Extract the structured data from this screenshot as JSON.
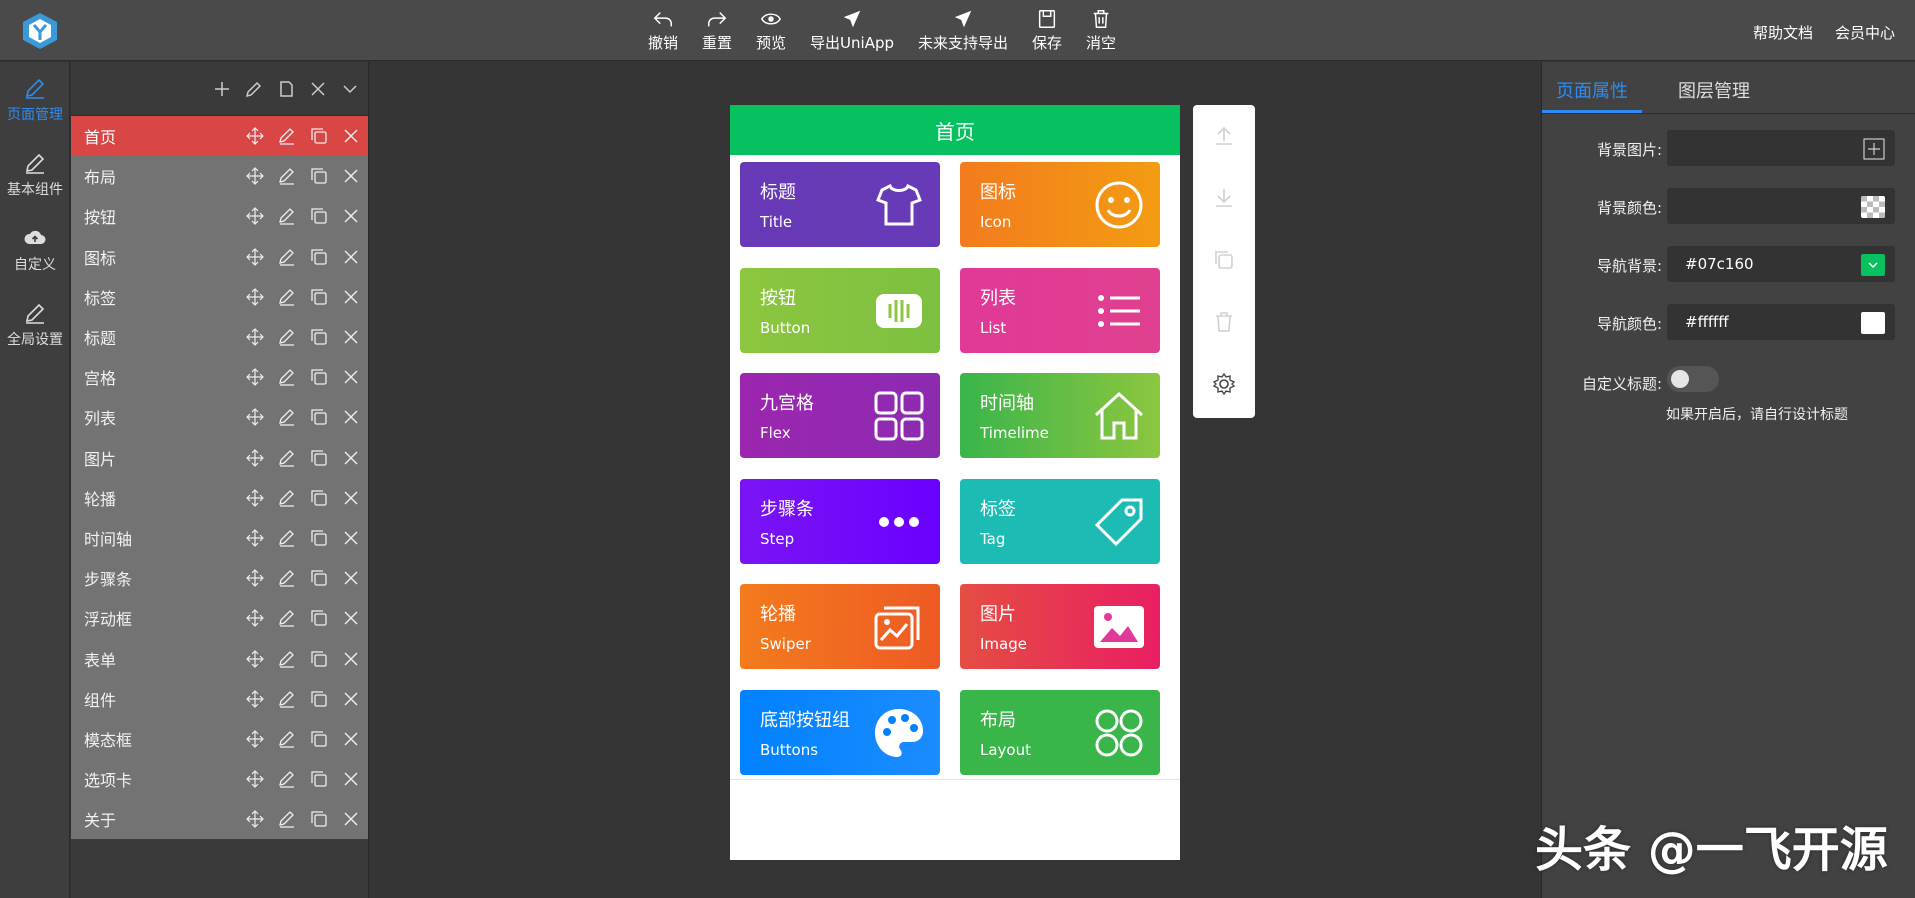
{
  "topbar": {
    "tools": [
      {
        "label": "撤销",
        "icon": "undo-icon"
      },
      {
        "label": "重置",
        "icon": "redo-icon"
      },
      {
        "label": "预览",
        "icon": "eye-icon"
      },
      {
        "label": "导出UniApp",
        "icon": "send-icon"
      },
      {
        "label": "未来支持导出",
        "icon": "send-icon"
      },
      {
        "label": "保存",
        "icon": "save-icon"
      },
      {
        "label": "消空",
        "icon": "trash-icon"
      }
    ],
    "links": [
      "帮助文档",
      "会员中心"
    ]
  },
  "leftnav": [
    {
      "label": "页面管理",
      "icon": "pencil-icon",
      "active": true
    },
    {
      "label": "基本组件",
      "icon": "pencil-icon",
      "active": false
    },
    {
      "label": "自定义",
      "icon": "cloud-upload-icon",
      "active": false
    },
    {
      "label": "全局设置",
      "icon": "pencil-icon",
      "active": false
    }
  ],
  "pages": [
    "首页",
    "布局",
    "按钮",
    "图标",
    "标签",
    "标题",
    "宫格",
    "列表",
    "图片",
    "轮播",
    "时间轴",
    "步骤条",
    "浮动框",
    "表单",
    "组件",
    "模态框",
    "选项卡",
    "关于"
  ],
  "phone": {
    "title": "首页",
    "cards": [
      {
        "title": "标题",
        "sub": "Title",
        "icon": "tshirt-icon",
        "bg": "#673ab7"
      },
      {
        "title": "图标",
        "sub": "Icon",
        "icon": "smile-icon",
        "bg": "#f37b1d"
      },
      {
        "title": "按钮",
        "sub": "Button",
        "icon": "button-icon",
        "bg": "#8dc63f"
      },
      {
        "title": "列表",
        "sub": "List",
        "icon": "list-icon",
        "bg": "#e03997"
      },
      {
        "title": "九宫格",
        "sub": "Flex",
        "icon": "grid-icon",
        "bg": "#9c26b0"
      },
      {
        "title": "时间轴",
        "sub": "Timelime",
        "icon": "home-icon",
        "bg": "#39b54a"
      },
      {
        "title": "步骤条",
        "sub": "Step",
        "icon": "dots-icon",
        "bg": "#6739b6"
      },
      {
        "title": "标签",
        "sub": "Tag",
        "icon": "tag-icon",
        "bg": "#1cbbb4"
      },
      {
        "title": "轮播",
        "sub": "Swiper",
        "icon": "slides-icon",
        "bg": "#f37b1d"
      },
      {
        "title": "图片",
        "sub": "Image",
        "icon": "image-icon",
        "bg": "#e54d42"
      },
      {
        "title": "底部按钮组",
        "sub": "Buttons",
        "icon": "palette-icon",
        "bg": "#0081ff"
      },
      {
        "title": "布局",
        "sub": "Layout",
        "icon": "layout-icon",
        "bg": "#39b54a"
      }
    ]
  },
  "props": {
    "tabs": [
      "页面属性",
      "图层管理"
    ],
    "bg_image_label": "背景图片:",
    "bg_color_label": "背景颜色:",
    "nav_bg_label": "导航背景:",
    "nav_bg_value": "#07c160",
    "nav_color_label": "导航颜色:",
    "nav_color_value": "#ffffff",
    "custom_title_label": "自定义标题:",
    "hint": "如果开启后，请自行设计标题"
  },
  "colors": {
    "accent": "#2e8cf0",
    "nav_green": "#07c160",
    "active_page": "#d94646"
  },
  "watermark": "头条 @一飞开源"
}
